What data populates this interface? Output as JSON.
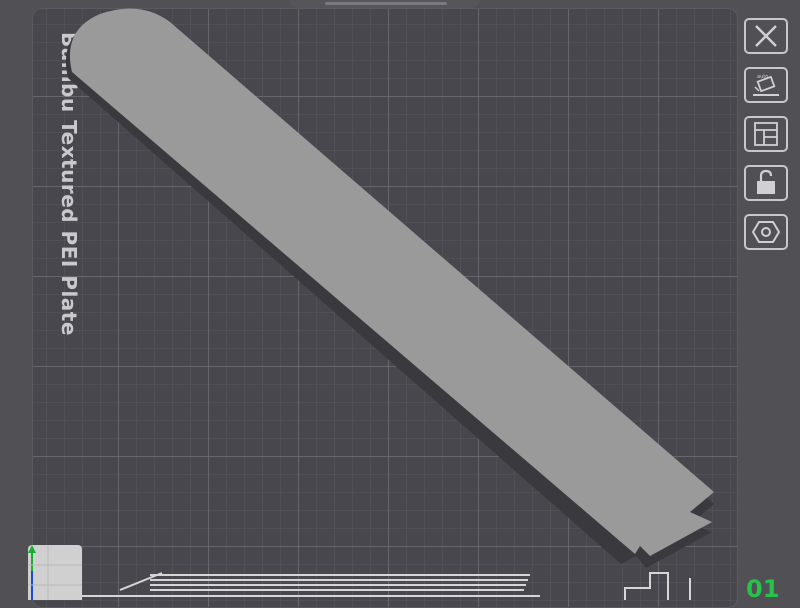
{
  "plate": {
    "label": "Bambu Textured PEI Plate",
    "number": "01"
  },
  "toolbar": {
    "items": [
      {
        "name": "close",
        "icon": "close-icon"
      },
      {
        "name": "auto-arrange",
        "icon": "auto-arrange-icon"
      },
      {
        "name": "layout",
        "icon": "layout-icon"
      },
      {
        "name": "lock",
        "icon": "lock-icon"
      },
      {
        "name": "settings",
        "icon": "hexagon-settings-icon"
      }
    ]
  },
  "colors": {
    "background": "#505055",
    "plate": "#47474d",
    "object": "#9a9a9a",
    "label": "#c9c9cd",
    "plate_number": "#27c24a"
  }
}
